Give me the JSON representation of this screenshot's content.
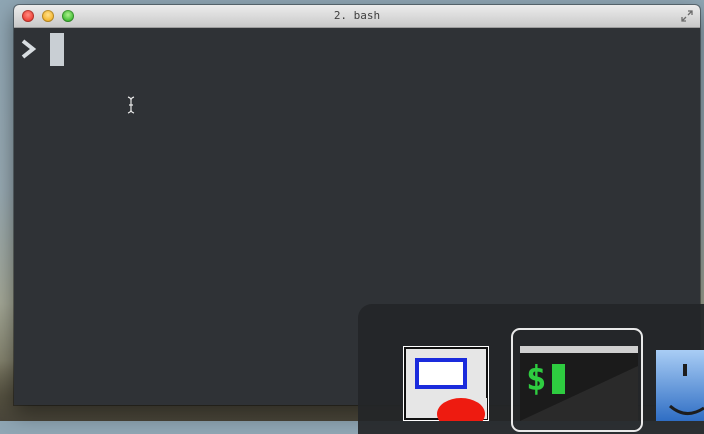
{
  "window": {
    "title": "2. bash"
  },
  "terminal": {
    "prompt_icon": "chevron-right-icon",
    "cursor": "block-cursor",
    "pointer": "i-beam-cursor-icon"
  },
  "dock": {
    "items": [
      {
        "icon": "drawing-app-icon"
      },
      {
        "icon": "terminal-app-icon",
        "glyph": "$",
        "glyph_color": "#2ecc40"
      },
      {
        "icon": "finder-icon"
      }
    ]
  },
  "colors": {
    "terminal_bg": "#2f3236",
    "cursor": "#c9cfd4",
    "dock_bg": "#242628"
  }
}
